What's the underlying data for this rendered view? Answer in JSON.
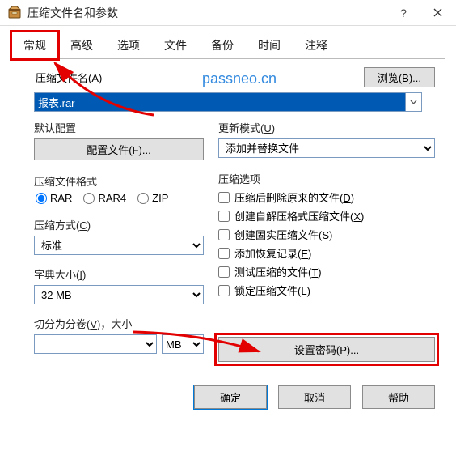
{
  "title": "压缩文件名和参数",
  "tabs": [
    "常规",
    "高级",
    "选项",
    "文件",
    "备份",
    "时间",
    "注释"
  ],
  "watermark": "passneo.cn",
  "archive_name_label_prefix": "压缩文件名(",
  "archive_name_label_hk": "A",
  "archive_name_label_suffix": ")",
  "browse_prefix": "浏览(",
  "browse_hk": "B",
  "browse_suffix": ")...",
  "filename": "报表.rar",
  "default_profile_label": "默认配置",
  "profiles_btn_prefix": "配置文件(",
  "profiles_btn_hk": "F",
  "profiles_btn_suffix": "...",
  "update_mode_label_prefix": "更新模式(",
  "update_mode_hk": "U",
  "update_mode_label_suffix": ")",
  "update_mode_value": "添加并替换文件",
  "format_label": "压缩文件格式",
  "fmt_rar": "RAR",
  "fmt_rar4": "RAR4",
  "fmt_zip": "ZIP",
  "method_label_prefix": "压缩方式(",
  "method_hk": "C",
  "method_label_suffix": ")",
  "method_value": "标准",
  "dict_label_prefix": "字典大小(",
  "dict_hk": "I",
  "dict_label_suffix": ")",
  "dict_value": "32 MB",
  "split_label_prefix": "切分为分卷(",
  "split_hk": "V",
  "split_label_suffix": ")，大小",
  "split_unit": "MB",
  "opts_label": "压缩选项",
  "opt1_prefix": "压缩后删除原来的文件(",
  "opt1_hk": "D",
  "opt1_suffix": ")",
  "opt2_prefix": "创建自解压格式压缩文件(",
  "opt2_hk": "X",
  "opt2_suffix": ")",
  "opt3_prefix": "创建固实压缩文件(",
  "opt3_hk": "S",
  "opt3_suffix": ")",
  "opt4_prefix": "添加恢复记录(",
  "opt4_hk": "E",
  "opt4_suffix": ")",
  "opt5_prefix": "测试压缩的文件(",
  "opt5_hk": "T",
  "opt5_suffix": ")",
  "opt6_prefix": "锁定压缩文件(",
  "opt6_hk": "L",
  "opt6_suffix": ")",
  "pwd_prefix": "设置密码(",
  "pwd_hk": "P",
  "pwd_suffix": ")...",
  "ok": "确定",
  "cancel": "取消",
  "help": "帮助",
  "help_q": "?"
}
